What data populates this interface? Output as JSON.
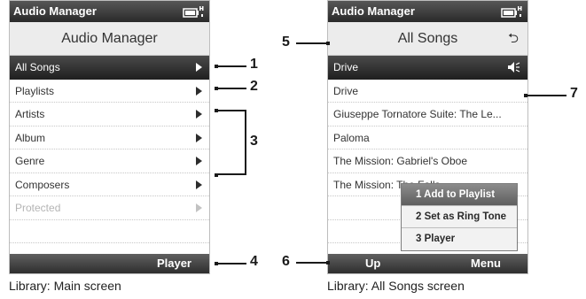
{
  "left_screen": {
    "title": "Audio Manager",
    "header": "Audio Manager",
    "items": [
      {
        "label": "All Songs"
      },
      {
        "label": "Playlists"
      },
      {
        "label": "Artists"
      },
      {
        "label": "Album"
      },
      {
        "label": "Genre"
      },
      {
        "label": "Composers"
      },
      {
        "label": "Protected"
      }
    ],
    "softkey_right": "Player",
    "caption": "Library: Main screen"
  },
  "right_screen": {
    "title": "Audio Manager",
    "header": "All Songs",
    "items": [
      {
        "label": "Drive"
      },
      {
        "label": "Drive"
      },
      {
        "label": "Giuseppe Tornatore Suite: The Le..."
      },
      {
        "label": "Paloma"
      },
      {
        "label": "The Mission: Gabriel's Oboe"
      },
      {
        "label": "The Mission: The Falls"
      }
    ],
    "menu": [
      {
        "label": "1 Add to Playlist"
      },
      {
        "label": "2 Set as Ring Tone"
      },
      {
        "label": "3 Player"
      }
    ],
    "softkey_left": "Up",
    "softkey_right": "Menu",
    "caption": "Library: All Songs screen"
  },
  "callouts": [
    "1",
    "2",
    "3",
    "4",
    "5",
    "6",
    "7"
  ],
  "colors": {
    "titlebar": "#2a2a2a",
    "selection": "#1f1f1f",
    "header_bg": "#ececec",
    "disabled_text": "#b4b4b4"
  },
  "icons": [
    "battery-icon",
    "signal-icon",
    "chevron-right-icon",
    "speaker-playing-icon",
    "back-arrow-icon"
  ]
}
